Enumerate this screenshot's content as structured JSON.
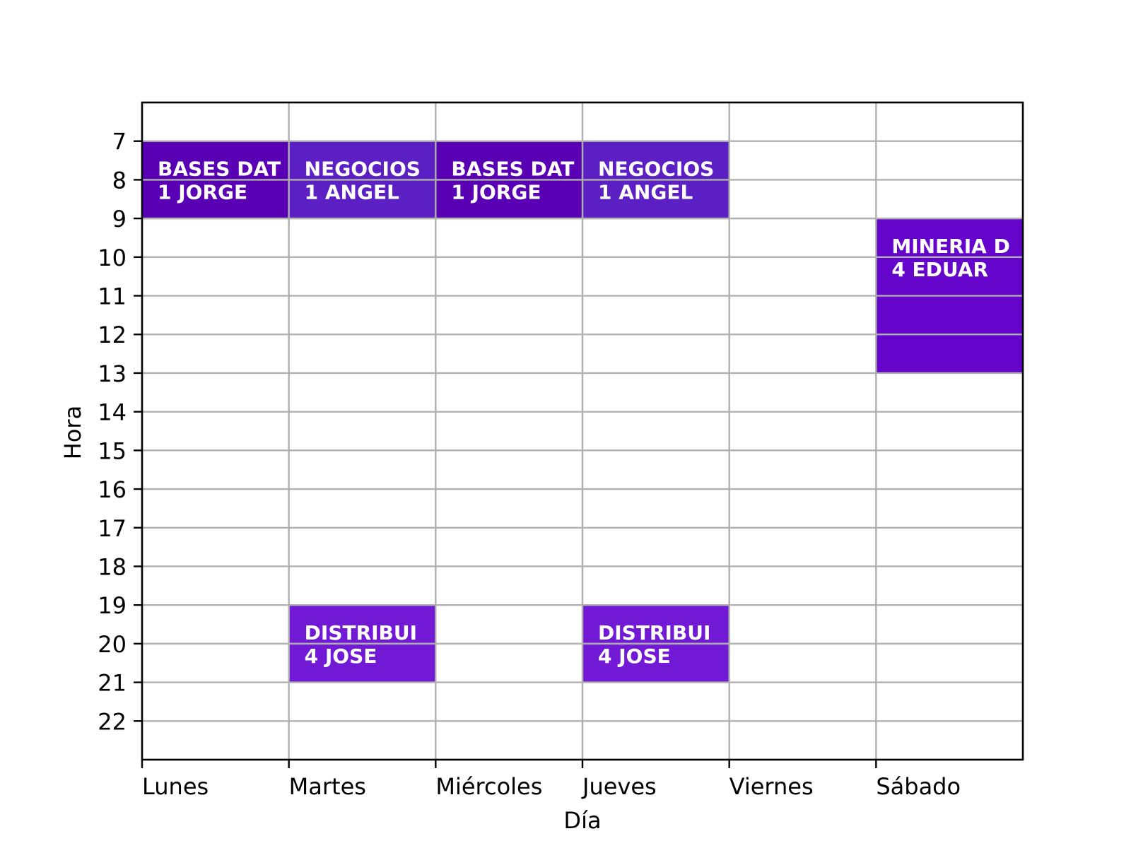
{
  "chart_data": {
    "type": "schedule",
    "xlabel": "Día",
    "ylabel": "Hora",
    "days": [
      "Lunes",
      "Martes",
      "Miércoles",
      "Jueves",
      "Viernes",
      "Sábado"
    ],
    "hour_ticks": [
      7,
      8,
      9,
      10,
      11,
      12,
      13,
      14,
      15,
      16,
      17,
      18,
      19,
      20,
      21,
      22
    ],
    "ylim": [
      6,
      23
    ],
    "grid": true,
    "events": [
      {
        "day": "Lunes",
        "start": 7,
        "end": 9,
        "line1": "BASES DAT",
        "line2": "1 JORGE",
        "color": "#5a00b4"
      },
      {
        "day": "Martes",
        "start": 7,
        "end": 9,
        "line1": "NEGOCIOS",
        "line2": "1 ANGEL",
        "color": "#5c1fc4"
      },
      {
        "day": "Miércoles",
        "start": 7,
        "end": 9,
        "line1": "BASES DAT",
        "line2": "1 JORGE",
        "color": "#5a00b4"
      },
      {
        "day": "Jueves",
        "start": 7,
        "end": 9,
        "line1": "NEGOCIOS",
        "line2": "1 ANGEL",
        "color": "#5c1fc4"
      },
      {
        "day": "Sábado",
        "start": 9,
        "end": 13,
        "line1": "MINERIA D",
        "line2": "4 EDUAR",
        "color": "#6505cb"
      },
      {
        "day": "Martes",
        "start": 19,
        "end": 21,
        "line1": "DISTRIBUI",
        "line2": "4 JOSE",
        "color": "#7219d6"
      },
      {
        "day": "Jueves",
        "start": 19,
        "end": 21,
        "line1": "DISTRIBUI",
        "line2": "4 JOSE",
        "color": "#7219d6"
      }
    ]
  }
}
